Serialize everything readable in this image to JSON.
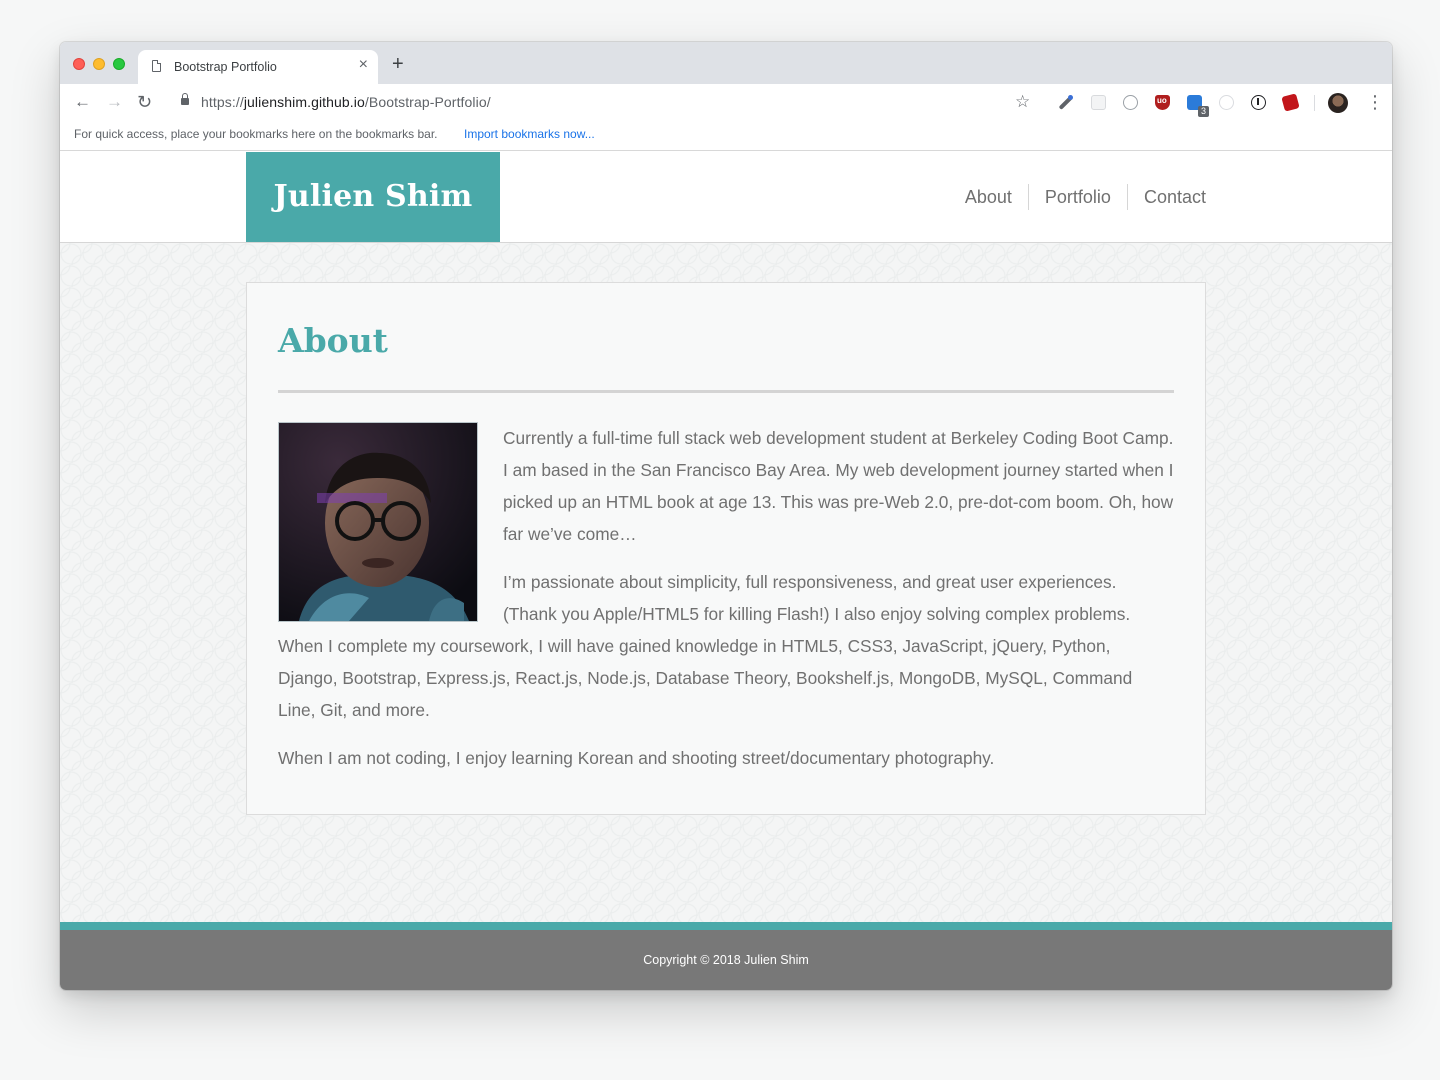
{
  "browser": {
    "tab_title": "Bootstrap Portfolio",
    "tab_close": "×",
    "new_tab": "+",
    "url_prefix": "https://",
    "url_host": "julienshim.github.io",
    "url_path": "/Bootstrap-Portfolio/",
    "extension_badge": "3",
    "bookmarks_text": "For quick access, place your bookmarks here on the bookmarks bar.",
    "bookmarks_link": "Import bookmarks now...",
    "icons": {
      "back": "←",
      "forward": "→",
      "reload": "↻",
      "star": "☆",
      "menu": "⋮"
    }
  },
  "site": {
    "brand": "Julien Shim",
    "nav": [
      "About",
      "Portfolio",
      "Contact"
    ],
    "about": {
      "heading": "About",
      "paragraphs": [
        "Currently a full-time full stack web development student at Berkeley Coding Boot Camp. I am based in the San Francisco Bay Area. My web development journey started when I picked up an HTML book at age 13. This was pre-Web 2.0, pre-dot-com boom. Oh, how far we’ve come…",
        "I’m passionate about simplicity, full responsiveness, and great user experiences. (Thank you Apple/HTML5 for killing Flash!) I also enjoy solving complex problems. When I complete my coursework, I will have gained knowledge in HTML5, CSS3, JavaScript, jQuery, Python, Django, Bootstrap, Express.js, React.js, Node.js, Database Theory, Bookshelf.js, MongoDB, MySQL, Command Line, Git, and more.",
        "When I am not coding, I enjoy learning Korean and shooting street/documentary photography."
      ]
    },
    "footer": "Copyright © 2018 Julien Shim"
  },
  "colors": {
    "accent": "#4aa9a9",
    "footer_bg": "#787878",
    "body_text": "#707070"
  }
}
